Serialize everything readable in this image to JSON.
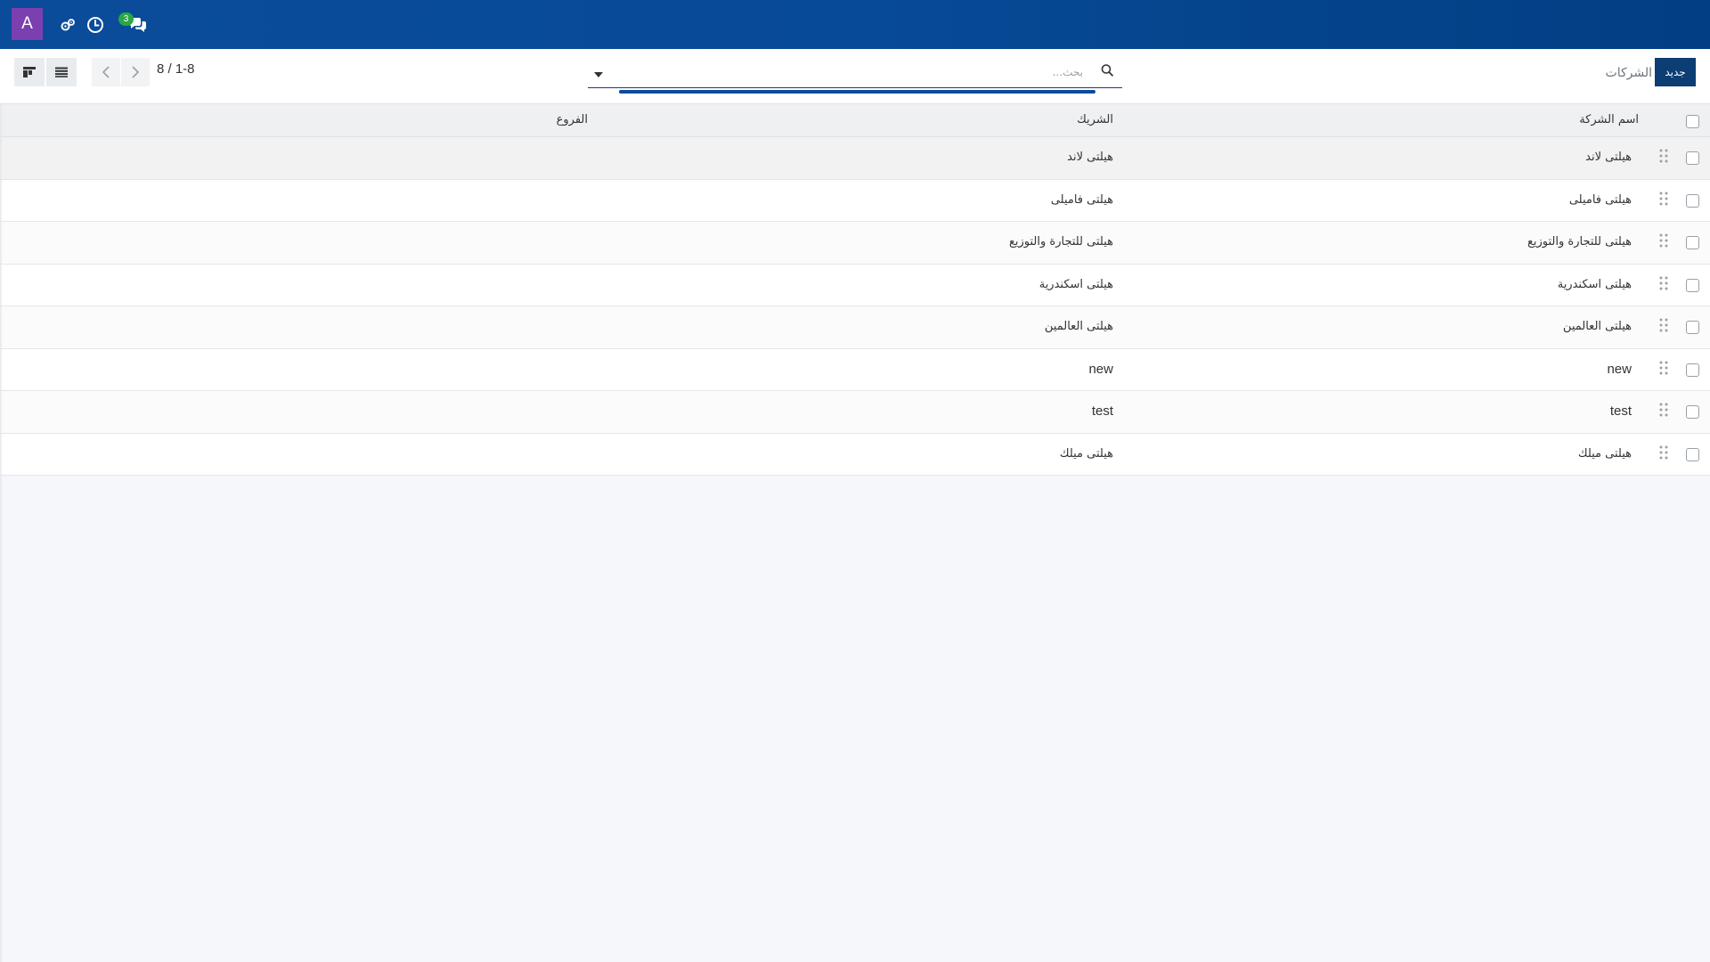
{
  "navbar": {
    "avatar_letter": "A",
    "icons": [
      "settings-gears-icon",
      "clock-icon",
      "chat-bubbles-icon"
    ],
    "messages_badge": "3",
    "color_start": "#0a4c9a",
    "color_end": "#023e83"
  },
  "control_panel": {
    "breadcrumb": "الشركات",
    "new_button": "جديد",
    "search_placeholder": "بحث...",
    "pager_value": "8 / 1-8",
    "views": [
      "kanban-view-icon",
      "list-view-icon"
    ]
  },
  "table": {
    "columns": {
      "name": "اسم الشركة",
      "partner": "الشريك",
      "branches": "الفروع"
    },
    "rows": [
      {
        "name": "هيلتى لاند",
        "partner": "هيلتى لاند",
        "branches": ""
      },
      {
        "name": "هيلتى فاميلى",
        "partner": "هيلتى فاميلى",
        "branches": ""
      },
      {
        "name": "هيلتى للتجارة والتوزيع",
        "partner": "هيلتى للتجارة والتوزيع",
        "branches": ""
      },
      {
        "name": "هيلتى اسكندرية",
        "partner": "هيلتى اسكندرية",
        "branches": ""
      },
      {
        "name": "هيلتى العالمين",
        "partner": "هيلتى العالمين",
        "branches": ""
      },
      {
        "name": "new",
        "partner": "new",
        "branches": ""
      },
      {
        "name": "test",
        "partner": "test",
        "branches": ""
      },
      {
        "name": "هيلتى ميلك",
        "partner": "هيلتى ميلك",
        "branches": ""
      }
    ]
  }
}
